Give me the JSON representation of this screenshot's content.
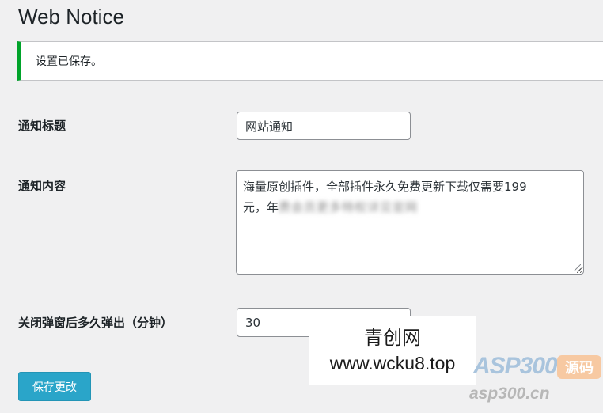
{
  "page": {
    "title": "Web Notice"
  },
  "notice": {
    "message": "设置已保存。"
  },
  "form": {
    "title_label": "通知标题",
    "title_value": "网站通知",
    "content_label": "通知内容",
    "content_line1": "海量原创插件，全部插件永久免费更新下载仅需要199",
    "content_line2": "元，年",
    "content_line2_obscured": "费会员更多特权详见官网",
    "popup_label": "关闭弹窗后多久弹出（分钟）",
    "popup_value": "30",
    "save_label": "保存更改"
  },
  "watermark": {
    "name": "青创网",
    "url": "www.wcku8.top",
    "logo_text": "ASP300",
    "logo_tag": "源码",
    "logo_url": "asp300.cn"
  },
  "colors": {
    "notice_border": "#00a32a",
    "button_bg": "#2aa5c9",
    "page_bg": "#f0f0f1"
  }
}
